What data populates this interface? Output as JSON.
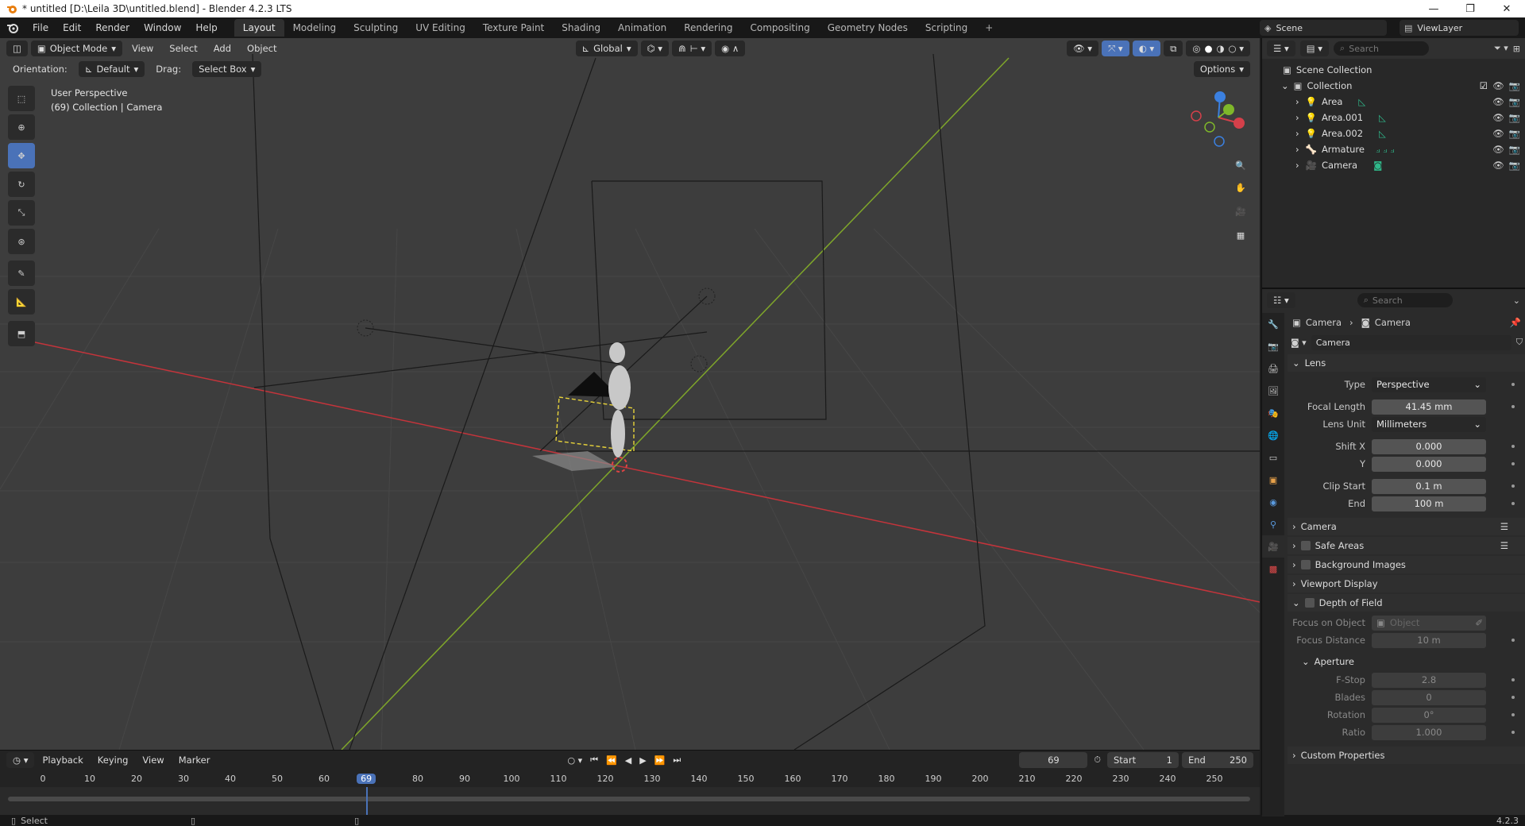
{
  "window": {
    "title": "* untitled [D:\\Leila 3D\\untitled.blend] - Blender 4.2.3 LTS",
    "controls": [
      "—",
      "❐",
      "✕"
    ]
  },
  "menus": [
    "File",
    "Edit",
    "Render",
    "Window",
    "Help"
  ],
  "workspaces": [
    "Layout",
    "Modeling",
    "Sculpting",
    "UV Editing",
    "Texture Paint",
    "Shading",
    "Animation",
    "Rendering",
    "Compositing",
    "Geometry Nodes",
    "Scripting"
  ],
  "workspace_plus": "+",
  "scene": "Scene",
  "view_layer": "ViewLayer",
  "viewport": {
    "mode": "Object Mode",
    "menus": [
      "View",
      "Select",
      "Add",
      "Object"
    ],
    "transform": "Global",
    "orientation_label": "Orientation:",
    "orientation": "Default",
    "drag_label": "Drag:",
    "drag": "Select Box",
    "options": "Options",
    "info_line1": "User Perspective",
    "info_line2": "(69) Collection | Camera"
  },
  "timeline": {
    "menus": [
      "Playback",
      "Keying",
      "View",
      "Marker"
    ],
    "current_frame": "69",
    "start_label": "Start",
    "start": "1",
    "end_label": "End",
    "end": "250",
    "ticks": [
      "0",
      "10",
      "20",
      "30",
      "40",
      "50",
      "60",
      "69",
      "80",
      "90",
      "100",
      "110",
      "120",
      "130",
      "140",
      "150",
      "160",
      "170",
      "180",
      "190",
      "200",
      "210",
      "220",
      "230",
      "240",
      "250"
    ]
  },
  "status": {
    "left": "Select",
    "version": "4.2.3"
  },
  "outliner": {
    "search_placeholder": "Search",
    "root": "Scene Collection",
    "collection": "Collection",
    "items": [
      "Area",
      "Area.001",
      "Area.002",
      "Armature",
      "Camera"
    ]
  },
  "properties": {
    "search_placeholder": "Search",
    "breadcrumb_object": "Camera",
    "breadcrumb_data": "Camera",
    "datablock": "Camera",
    "lens_header": "Lens",
    "type_label": "Type",
    "type_value": "Perspective",
    "focal_label": "Focal Length",
    "focal_value": "41.45 mm",
    "lens_unit_label": "Lens Unit",
    "lens_unit_value": "Millimeters",
    "shiftx_label": "Shift X",
    "shiftx_value": "0.000",
    "shifty_label": "Y",
    "shifty_value": "0.000",
    "clipstart_label": "Clip Start",
    "clipstart_value": "0.1 m",
    "clipend_label": "End",
    "clipend_value": "100 m",
    "panel_camera": "Camera",
    "panel_safe": "Safe Areas",
    "panel_bg": "Background Images",
    "panel_vd": "Viewport Display",
    "panel_dof": "Depth of Field",
    "focus_obj_label": "Focus on Object",
    "focus_obj_placeholder": "Object",
    "focus_dist_label": "Focus Distance",
    "focus_dist_value": "10 m",
    "aperture_header": "Aperture",
    "fstop_label": "F-Stop",
    "fstop_value": "2.8",
    "blades_label": "Blades",
    "blades_value": "0",
    "rotation_label": "Rotation",
    "rotation_value": "0°",
    "ratio_label": "Ratio",
    "ratio_value": "1.000",
    "panel_custom": "Custom Properties"
  },
  "colors": {
    "accent": "#4a72b8",
    "x_axis": "#c4343b",
    "y_axis": "#7fa62a",
    "selection": "#e8d33a"
  }
}
